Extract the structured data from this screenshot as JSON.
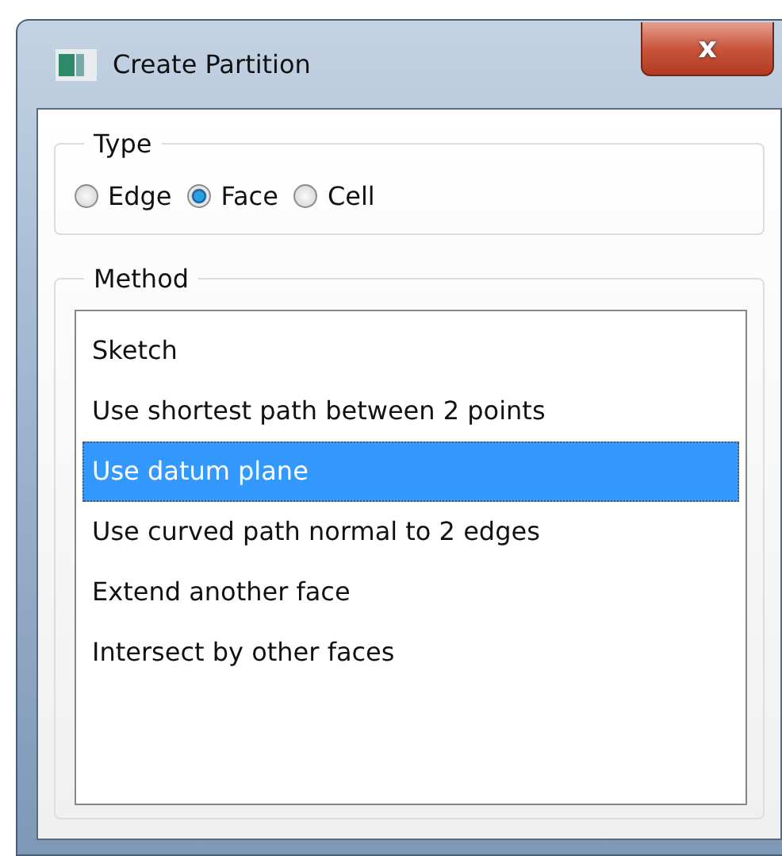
{
  "window": {
    "title": "Create Partition",
    "close": "x"
  },
  "type_group": {
    "title": "Type",
    "options": [
      {
        "label": "Edge",
        "selected": false
      },
      {
        "label": "Face",
        "selected": true
      },
      {
        "label": "Cell",
        "selected": false
      }
    ]
  },
  "method_group": {
    "title": "Method",
    "items": [
      {
        "label": "Sketch",
        "selected": false
      },
      {
        "label": "Use shortest path between 2 points",
        "selected": false
      },
      {
        "label": "Use datum plane",
        "selected": true
      },
      {
        "label": "Use curved path normal to 2 edges",
        "selected": false
      },
      {
        "label": "Extend another face",
        "selected": false
      },
      {
        "label": "Intersect by other faces",
        "selected": false
      }
    ]
  }
}
